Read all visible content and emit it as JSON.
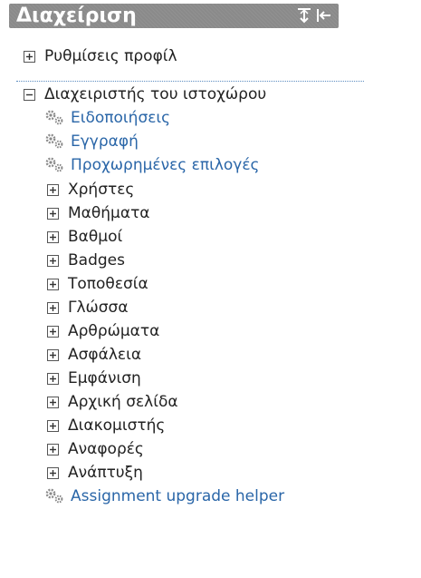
{
  "block": {
    "title": "Διαχείριση"
  },
  "tree": {
    "profile_settings": "Ρυθμίσεις προφίλ",
    "site_admin": "Διαχειριστής του ιστοχώρου",
    "links": [
      "Ειδοποιήσεις",
      "Εγγραφή",
      "Προχωρημένες επιλογές"
    ],
    "categories": [
      "Χρήστες",
      "Μαθήματα",
      "Βαθμοί",
      "Badges",
      "Τοποθεσία",
      "Γλώσσα",
      "Αρθρώματα",
      "Ασφάλεια",
      "Εμφάνιση",
      "Αρχική σελίδα",
      "Διακομιστής",
      "Αναφορές",
      "Ανάπτυξη"
    ],
    "last_link": "Assignment upgrade helper"
  },
  "colors": {
    "header_bg": "#8a8a8a",
    "link": "#2a66a8",
    "text": "#222222"
  }
}
